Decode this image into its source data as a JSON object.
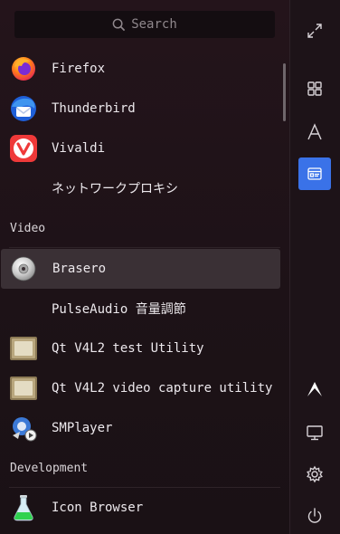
{
  "search": {
    "placeholder": "Search"
  },
  "apps": {
    "firefox": "Firefox",
    "thunderbird": "Thunderbird",
    "vivaldi": "Vivaldi",
    "proxy": "ネットワークプロキシ",
    "brasero": "Brasero",
    "pulseaudio": "PulseAudio 音量調節",
    "qt_test": "Qt V4L2 test Utility",
    "qt_capture": "Qt V4L2 video capture utility",
    "smplayer": "SMPlayer",
    "icon_browser": "Icon Browser"
  },
  "sections": {
    "video": "Video",
    "development": "Development"
  },
  "rail": {
    "icons": [
      "expand-icon",
      "grid-icon",
      "alphabet-icon",
      "categories-icon",
      "arch-logo-icon",
      "monitor-icon",
      "settings-icon",
      "power-icon"
    ],
    "active": "categories-icon"
  },
  "colors": {
    "accent": "#3a72e8",
    "selection": "#3a3035"
  }
}
